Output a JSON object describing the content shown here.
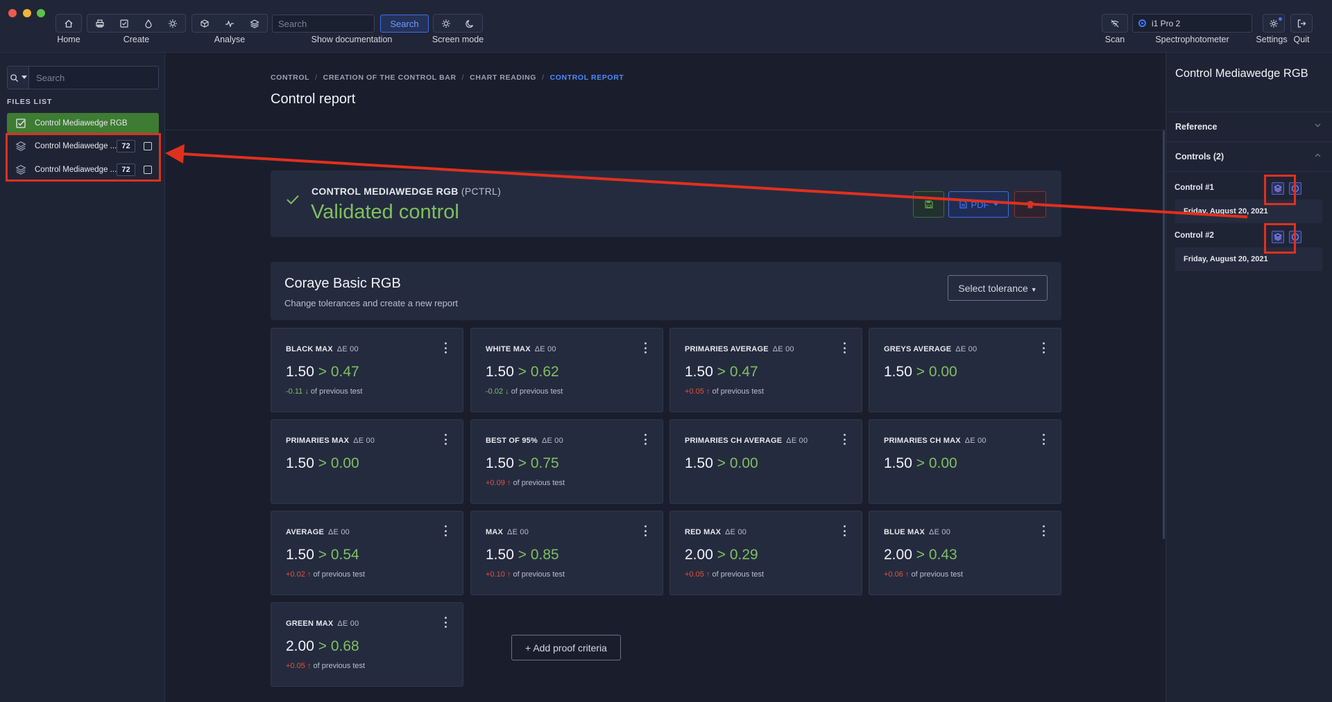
{
  "toolbar": {
    "groups": [
      {
        "label": "Home",
        "icons": [
          "home-icon"
        ]
      },
      {
        "label": "Create",
        "icons": [
          "printer-icon",
          "checklist-icon",
          "drop-icon",
          "sun-icon"
        ]
      },
      {
        "label": "Analyse",
        "icons": [
          "cube-icon",
          "pulse-icon",
          "layers-icon"
        ]
      },
      {
        "label": "Screen mode",
        "icons": [
          "sun-icon",
          "moon-icon"
        ]
      }
    ],
    "search_placeholder": "Search",
    "search_button": "Search",
    "show_documentation": "Show documentation",
    "scan_label": "Scan",
    "device_name": "i1 Pro 2",
    "device_label": "Spectrophotometer",
    "settings_label": "Settings",
    "quit_label": "Quit"
  },
  "sidebar": {
    "search_placeholder": "Search",
    "files_title": "FILES LIST",
    "files": [
      {
        "name": "Control Mediawedge RGB",
        "active": true
      },
      {
        "name": "Control Mediawedge ...",
        "count": "72"
      },
      {
        "name": "Control Mediawedge ...",
        "count": "72"
      }
    ]
  },
  "main": {
    "breadcrumbs": [
      "CONTROL",
      "CREATION OF THE CONTROL BAR",
      "CHART READING",
      "CONTROL REPORT"
    ],
    "page_title": "Control report",
    "status": {
      "name": "CONTROL MEDIAWEDGE RGB",
      "code": "(PCTRL)",
      "state": "Validated control",
      "pdf_label": "PDF"
    },
    "tolerance": {
      "title": "Coraye Basic RGB",
      "subtitle": "Change tolerances and create a new report",
      "select_label": "Select tolerance"
    },
    "cards": [
      {
        "title": "BLACK MAX",
        "unit": "ΔE 00",
        "tol": "1.50",
        "result": "> 0.47",
        "delta": "-0.11",
        "dir": "down",
        "suffix": "of previous test"
      },
      {
        "title": "WHITE MAX",
        "unit": "ΔE 00",
        "tol": "1.50",
        "result": "> 0.62",
        "delta": "-0.02",
        "dir": "down",
        "suffix": "of previous test"
      },
      {
        "title": "PRIMARIES AVERAGE",
        "unit": "ΔE 00",
        "tol": "1.50",
        "result": "> 0.47",
        "delta": "+0.05",
        "dir": "up",
        "suffix": "of previous test"
      },
      {
        "title": "GREYS AVERAGE",
        "unit": "ΔE 00",
        "tol": "1.50",
        "result": "> 0.00",
        "delta": "",
        "dir": "",
        "suffix": ""
      },
      {
        "title": "PRIMARIES MAX",
        "unit": "ΔE 00",
        "tol": "1.50",
        "result": "> 0.00",
        "delta": "",
        "dir": "",
        "suffix": ""
      },
      {
        "title": "BEST OF 95%",
        "unit": "ΔE 00",
        "tol": "1.50",
        "result": "> 0.75",
        "delta": "+0.09",
        "dir": "up",
        "suffix": "of previous test"
      },
      {
        "title": "PRIMARIES CH AVERAGE",
        "unit": "ΔE 00",
        "tol": "1.50",
        "result": "> 0.00",
        "delta": "",
        "dir": "",
        "suffix": ""
      },
      {
        "title": "PRIMARIES CH MAX",
        "unit": "ΔE 00",
        "tol": "1.50",
        "result": "> 0.00",
        "delta": "",
        "dir": "",
        "suffix": ""
      },
      {
        "title": "AVERAGE",
        "unit": "ΔE 00",
        "tol": "1.50",
        "result": "> 0.54",
        "delta": "+0.02",
        "dir": "up",
        "suffix": "of previous test"
      },
      {
        "title": "MAX",
        "unit": "ΔE 00",
        "tol": "1.50",
        "result": "> 0.85",
        "delta": "+0.10",
        "dir": "up",
        "suffix": "of previous test"
      },
      {
        "title": "RED MAX",
        "unit": "ΔE 00",
        "tol": "2.00",
        "result": "> 0.29",
        "delta": "+0.05",
        "dir": "up",
        "suffix": "of previous test"
      },
      {
        "title": "BLUE MAX",
        "unit": "ΔE 00",
        "tol": "2.00",
        "result": "> 0.43",
        "delta": "+0.06",
        "dir": "up",
        "suffix": "of previous test"
      },
      {
        "title": "GREEN MAX",
        "unit": "ΔE 00",
        "tol": "2.00",
        "result": "> 0.68",
        "delta": "+0.05",
        "dir": "up",
        "suffix": "of previous test"
      }
    ],
    "add_criteria": "+ Add proof criteria"
  },
  "right_panel": {
    "title": "Control Mediawedge RGB",
    "reference_label": "Reference",
    "controls_label": "Controls (2)",
    "controls": [
      {
        "label": "Control #1",
        "date": "Friday, August 20, 2021"
      },
      {
        "label": "Control #2",
        "date": "Friday, August 20, 2021"
      }
    ]
  },
  "colors": {
    "background": "#1a1e2c",
    "accent": "#3f7aff",
    "success": "#7fc062",
    "danger": "#e0533f",
    "annotation": "#e0301e"
  }
}
